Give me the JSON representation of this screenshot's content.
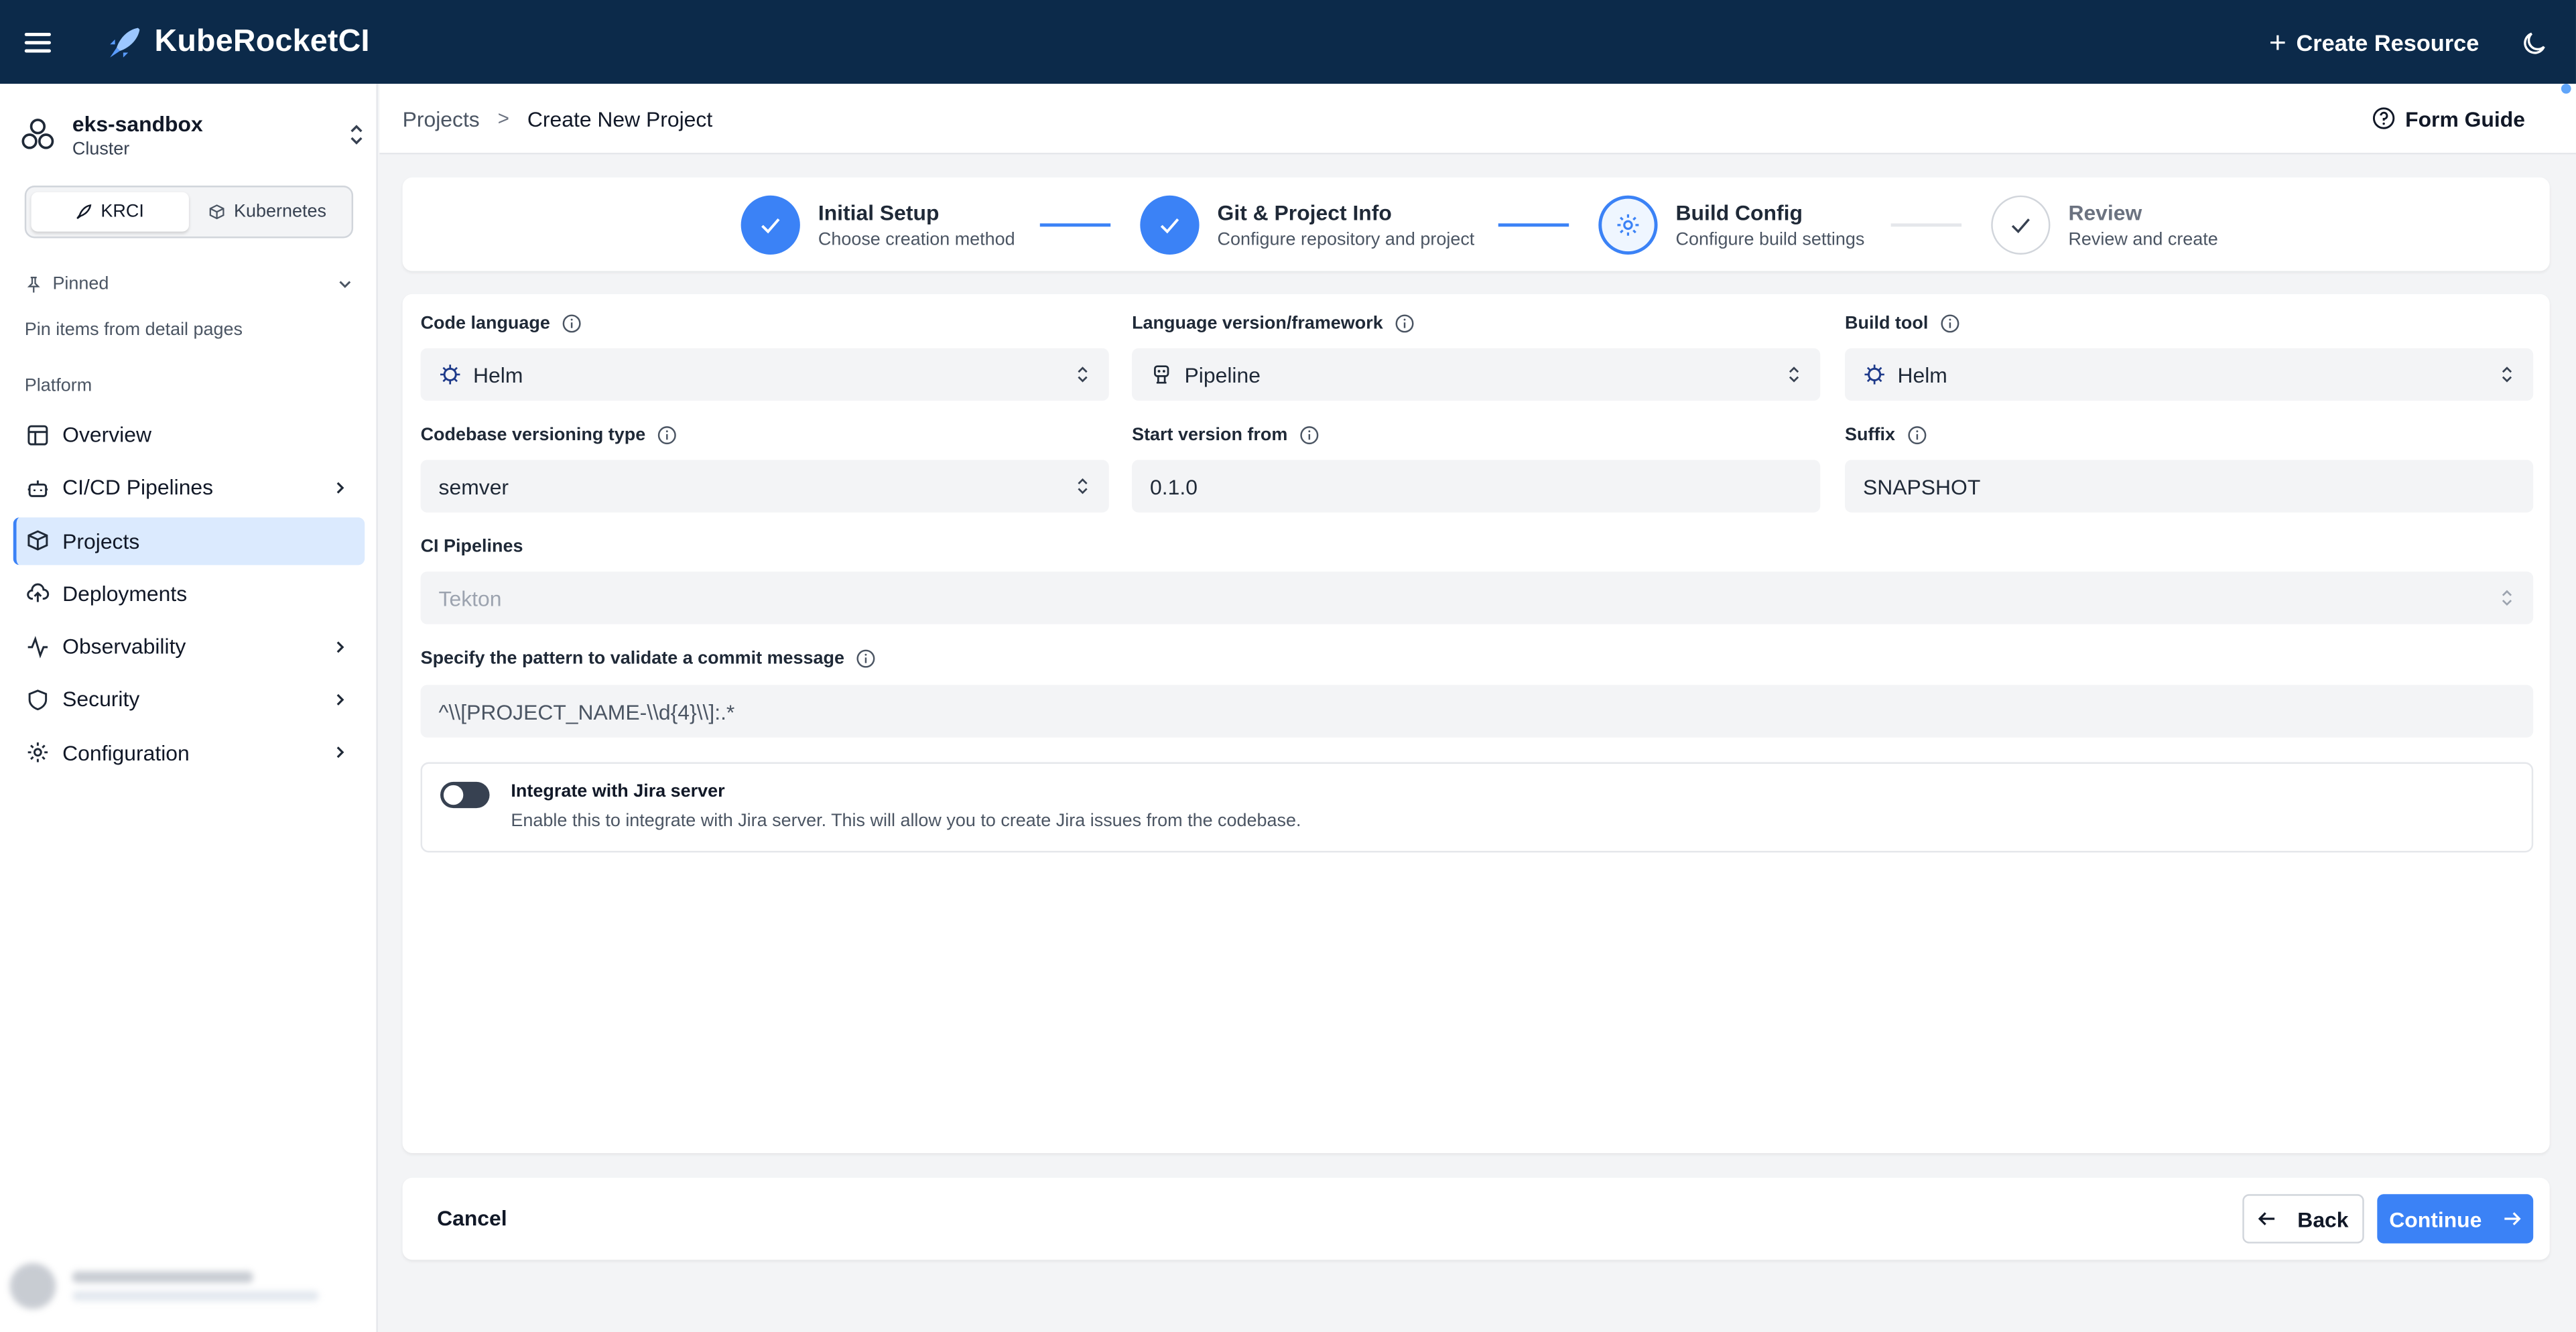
{
  "app": {
    "title": "KubeRocketCI",
    "create_resource": "Create Resource"
  },
  "sidebar": {
    "cluster_name": "eks-sandbox",
    "cluster_label": "Cluster",
    "segments": [
      "KRCI",
      "Kubernetes"
    ],
    "pinned_label": "Pinned",
    "pinned_hint": "Pin items from detail pages",
    "section_label": "Platform",
    "items": [
      {
        "label": "Overview",
        "icon": "table-icon",
        "expandable": false
      },
      {
        "label": "CI/CD Pipelines",
        "icon": "bot-icon",
        "expandable": true
      },
      {
        "label": "Projects",
        "icon": "box-icon",
        "expandable": false,
        "active": true
      },
      {
        "label": "Deployments",
        "icon": "cloud-upload-icon",
        "expandable": false
      },
      {
        "label": "Observability",
        "icon": "activity-icon",
        "expandable": true
      },
      {
        "label": "Security",
        "icon": "shield-icon",
        "expandable": true
      },
      {
        "label": "Configuration",
        "icon": "gear-icon",
        "expandable": true
      }
    ]
  },
  "breadcrumb": {
    "parent": "Projects",
    "current": "Create New Project"
  },
  "form_guide": "Form Guide",
  "stepper": [
    {
      "title": "Initial Setup",
      "subtitle": "Choose creation method",
      "state": "done"
    },
    {
      "title": "Git & Project Info",
      "subtitle": "Configure repository and project",
      "state": "done"
    },
    {
      "title": "Build Config",
      "subtitle": "Configure build settings",
      "state": "current"
    },
    {
      "title": "Review",
      "subtitle": "Review and create",
      "state": "todo"
    }
  ],
  "form": {
    "code_language": {
      "label": "Code language",
      "value": "Helm"
    },
    "language_version": {
      "label": "Language version/framework",
      "value": "Pipeline"
    },
    "build_tool": {
      "label": "Build tool",
      "value": "Helm"
    },
    "versioning_type": {
      "label": "Codebase versioning type",
      "value": "semver"
    },
    "start_version": {
      "label": "Start version from",
      "value": "0.1.0"
    },
    "suffix": {
      "label": "Suffix",
      "value": "SNAPSHOT"
    },
    "ci_pipelines": {
      "label": "CI Pipelines",
      "value": "Tekton"
    },
    "commit_pattern": {
      "label": "Specify the pattern to validate a commit message",
      "value": "^\\\\[PROJECT_NAME-\\\\d{4}\\\\]:.*"
    },
    "jira": {
      "title": "Integrate with Jira server",
      "description": "Enable this to integrate with Jira server. This will allow you to create Jira issues from the codebase.",
      "enabled": false
    }
  },
  "footer": {
    "cancel": "Cancel",
    "back": "Back",
    "continue": "Continue"
  },
  "colors": {
    "topbar": "#0c2a4a",
    "accent": "#3b82f6",
    "active_nav": "#dbeafe"
  }
}
